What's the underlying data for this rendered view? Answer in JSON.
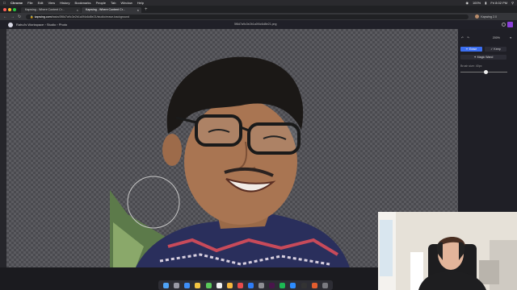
{
  "menubar": {
    "app": "Chrome",
    "items": [
      "File",
      "Edit",
      "View",
      "History",
      "Bookmarks",
      "People",
      "Tab",
      "Window",
      "Help"
    ],
    "battery": "100%",
    "clock": "Fri 8:02 PM"
  },
  "tabs": [
    {
      "title": "Kapwing - Where Content Cr..."
    },
    {
      "title": "Kapwing - Where Content Cr..."
    }
  ],
  "address": {
    "domain": "kapwing.com",
    "path": "/tasks/5f8d7a9c3e2b1a0f4c6d8e21/studio/erase-background"
  },
  "profile": {
    "name": "Kapwing 2.0"
  },
  "app": {
    "breadcrumb": "Rahul's Workspace › Studio › Photo",
    "filename": "5f8d7a9c3e2b1a0f4c6d8e21.png"
  },
  "panel": {
    "zoom": "200%",
    "erase_label": "Erase",
    "keep_label": "Keep",
    "magic_label": "Magic Wand",
    "brush_label": "Brush size: 40px",
    "brush_value": 0.55
  },
  "colors": {
    "accent": "#3b6ef0",
    "avatar": "#8b3fd9",
    "brush_circle": "#c8c8c8"
  },
  "icons": [
    "apple-icon",
    "undo-icon",
    "redo-icon",
    "help-icon",
    "eraser-icon",
    "keep-icon",
    "magic-wand-icon",
    "wifi-icon",
    "battery-icon",
    "search-icon"
  ]
}
